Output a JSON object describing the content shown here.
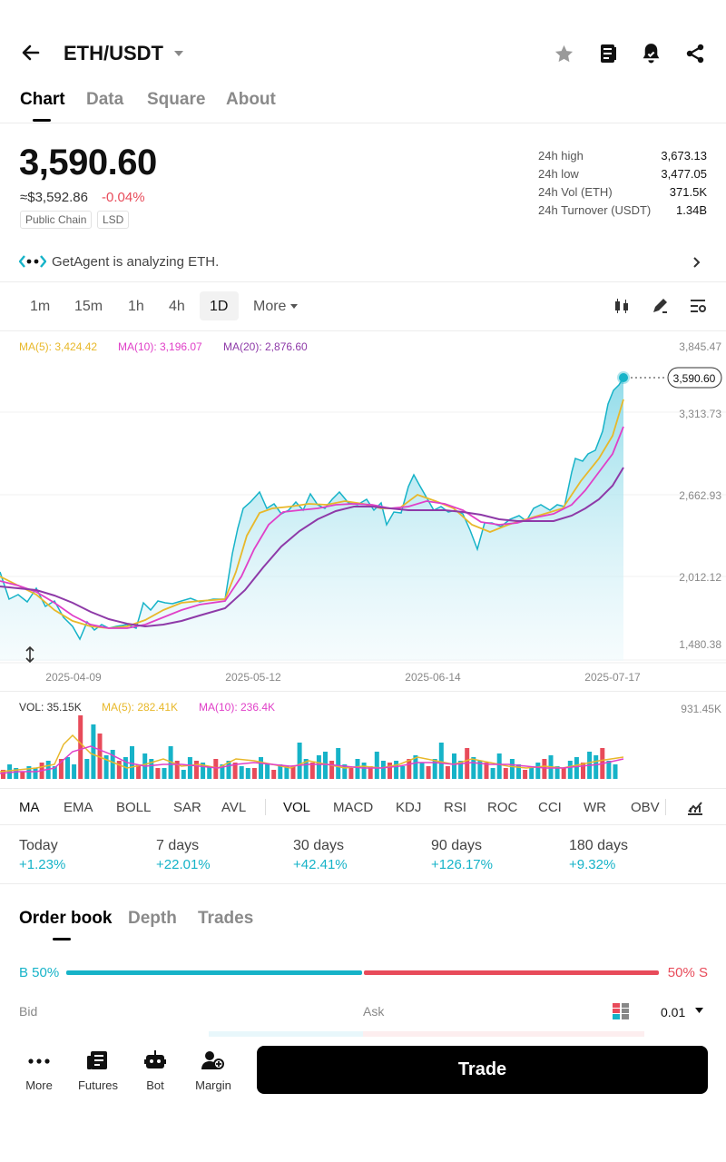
{
  "header": {
    "title": "ETH/USDT"
  },
  "tabs": [
    "Chart",
    "Data",
    "Square",
    "About"
  ],
  "price": {
    "last": "3,590.60",
    "approx": "≈$3,592.86",
    "change": "-0.04%",
    "tags": [
      "Public Chain",
      "LSD"
    ]
  },
  "stats": [
    {
      "label": "24h high",
      "value": "3,673.13"
    },
    {
      "label": "24h low",
      "value": "3,477.05"
    },
    {
      "label": "24h Vol (ETH)",
      "value": "371.5K"
    },
    {
      "label": "24h Turnover (USDT)",
      "value": "1.34B"
    }
  ],
  "agent": {
    "text": "GetAgent is analyzing ETH."
  },
  "timeframes": [
    "1m",
    "15m",
    "1h",
    "4h",
    "1D"
  ],
  "more_label": "More",
  "ma_legend": {
    "ma5": "MA(5): 3,424.42",
    "ma10": "MA(10): 3,196.07",
    "ma20": "MA(20): 2,876.60"
  },
  "price_axis": [
    "3,845.47",
    "3,313.73",
    "2,662.93",
    "2,012.12",
    "1,480.38"
  ],
  "last_price_tag": "3,590.60",
  "date_axis": [
    "2025-04-09",
    "2025-05-12",
    "2025-06-14",
    "2025-07-17"
  ],
  "vol_legend": {
    "vol": "VOL: 35.15K",
    "ma5": "MA(5): 282.41K",
    "ma10": "MA(10): 236.4K"
  },
  "vol_axis": "931.45K",
  "indicators": [
    "MA",
    "EMA",
    "BOLL",
    "SAR",
    "AVL",
    "VOL",
    "MACD",
    "KDJ",
    "RSI",
    "ROC",
    "CCI",
    "WR",
    "OBV"
  ],
  "performance": [
    {
      "label": "Today",
      "value": "+1.23%"
    },
    {
      "label": "7 days",
      "value": "+22.01%"
    },
    {
      "label": "30 days",
      "value": "+42.41%"
    },
    {
      "label": "90 days",
      "value": "+126.17%"
    },
    {
      "label": "180 days",
      "value": "+9.32%"
    }
  ],
  "orderbook": {
    "tabs": [
      "Order book",
      "Depth",
      "Trades"
    ],
    "buy_label": "B 50%",
    "sell_label": "50% S",
    "buy_ratio": 0.5,
    "bid": "Bid",
    "ask": "Ask",
    "precision": "0.01"
  },
  "bottom_nav": [
    {
      "label": "More"
    },
    {
      "label": "Futures"
    },
    {
      "label": "Bot"
    },
    {
      "label": "Margin"
    }
  ],
  "trade_button": "Trade",
  "colors": {
    "accent": "#16b3c8",
    "down": "#e84b5a",
    "ma5": "#e8b82a",
    "ma10": "#e040c8",
    "ma20": "#8e3aa8"
  }
}
